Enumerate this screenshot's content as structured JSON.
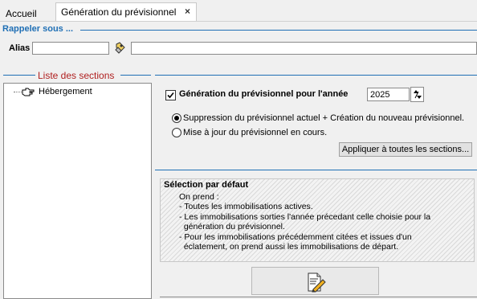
{
  "tabs": [
    {
      "label": "Accueil",
      "active": false
    },
    {
      "label": "Génération du prévisionnel",
      "active": true,
      "close": "×"
    }
  ],
  "rappeler": {
    "title": "Rappeler sous ...",
    "alias_label": "Alias",
    "alias_value": "",
    "description_value": "",
    "lookup_icon": "binoculars-icon"
  },
  "sections": {
    "title": "Liste des sections",
    "items": [
      {
        "label": "Hébergement",
        "icon": "pointing-hand-icon"
      }
    ]
  },
  "generation": {
    "checkbox_label": "Génération du prévisionnel pour l'année",
    "checked": true,
    "year": "2025",
    "options": [
      {
        "label": "Suppression du prévisionnel actuel + Création du nouveau prévisionnel.",
        "selected": true
      },
      {
        "label": "Mise à jour du prévisionnel en cours.",
        "selected": false
      }
    ],
    "apply_button": "Appliquer à toutes les sections..."
  },
  "selection": {
    "title": "Sélection par défaut",
    "text": "On prend :\n- Toutes les immobilisations actives.\n- Les immobilisations sorties l'année précedant celle choisie pour la\n  génération du prévisionnel.\n- Pour les immobilisations précédemment citées et issues d'un\n  éclatement, on prend aussi les immobilisations de départ."
  },
  "action_button": {
    "icon": "document-edit-icon"
  },
  "colors": {
    "accent": "#1f6fb5",
    "section_title": "#b02020"
  }
}
